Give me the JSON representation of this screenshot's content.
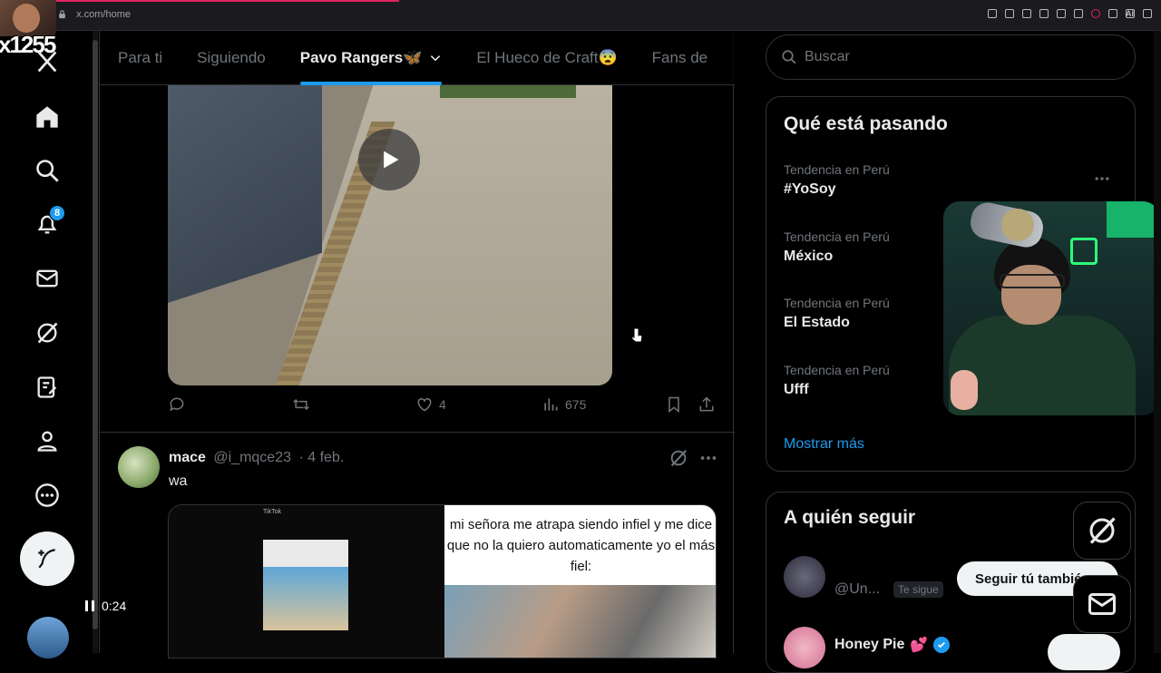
{
  "browser": {
    "url": "x.com/home",
    "ai_label": "AI"
  },
  "streamer": {
    "overlay_text": "x1255"
  },
  "sidebar": {
    "items": [
      {
        "name": "x-logo"
      },
      {
        "name": "home"
      },
      {
        "name": "explore"
      },
      {
        "name": "notifications",
        "badge": "8"
      },
      {
        "name": "messages"
      },
      {
        "name": "grok"
      },
      {
        "name": "lists"
      },
      {
        "name": "profile"
      },
      {
        "name": "more"
      }
    ]
  },
  "tabs": [
    {
      "label": "Para ti"
    },
    {
      "label": "Siguiendo"
    },
    {
      "label": "Pavo Rangers🦋",
      "active": true
    },
    {
      "label": "El Hueco de Craft😨"
    },
    {
      "label": "Fans de"
    }
  ],
  "post1": {
    "stats": {
      "likes": "4",
      "views": "675"
    }
  },
  "post2": {
    "name": "mace",
    "handle": "@i_mqce23",
    "date": "· 4 feb.",
    "text": "wa",
    "video_caption": "mi señora me atrapa siendo infiel y me dice que no la quiero automaticamente yo el más fiel:",
    "tiktok_label": "TikTok",
    "timestamp": "0:24"
  },
  "right": {
    "search_placeholder": "Buscar",
    "trends_title": "Qué está pasando",
    "trends": [
      {
        "context": "Tendencia en Perú",
        "title": "#YoSoy"
      },
      {
        "context": "Tendencia en Perú",
        "title": "México"
      },
      {
        "context": "Tendencia en Perú",
        "title": "El Estado"
      },
      {
        "context": "Tendencia en Perú",
        "title": "Ufff"
      }
    ],
    "show_more": "Mostrar más",
    "follow_title": "A quién seguir",
    "follow": [
      {
        "handle": "@Un...",
        "follows_you": "Te sigue",
        "button": "Seguir tú también"
      },
      {
        "name": "Honey Pie",
        "emoji": "💕"
      }
    ]
  },
  "colors": {
    "accent": "#1d9bf0",
    "background": "#000000",
    "border": "#2f3336",
    "muted": "#71767b"
  }
}
